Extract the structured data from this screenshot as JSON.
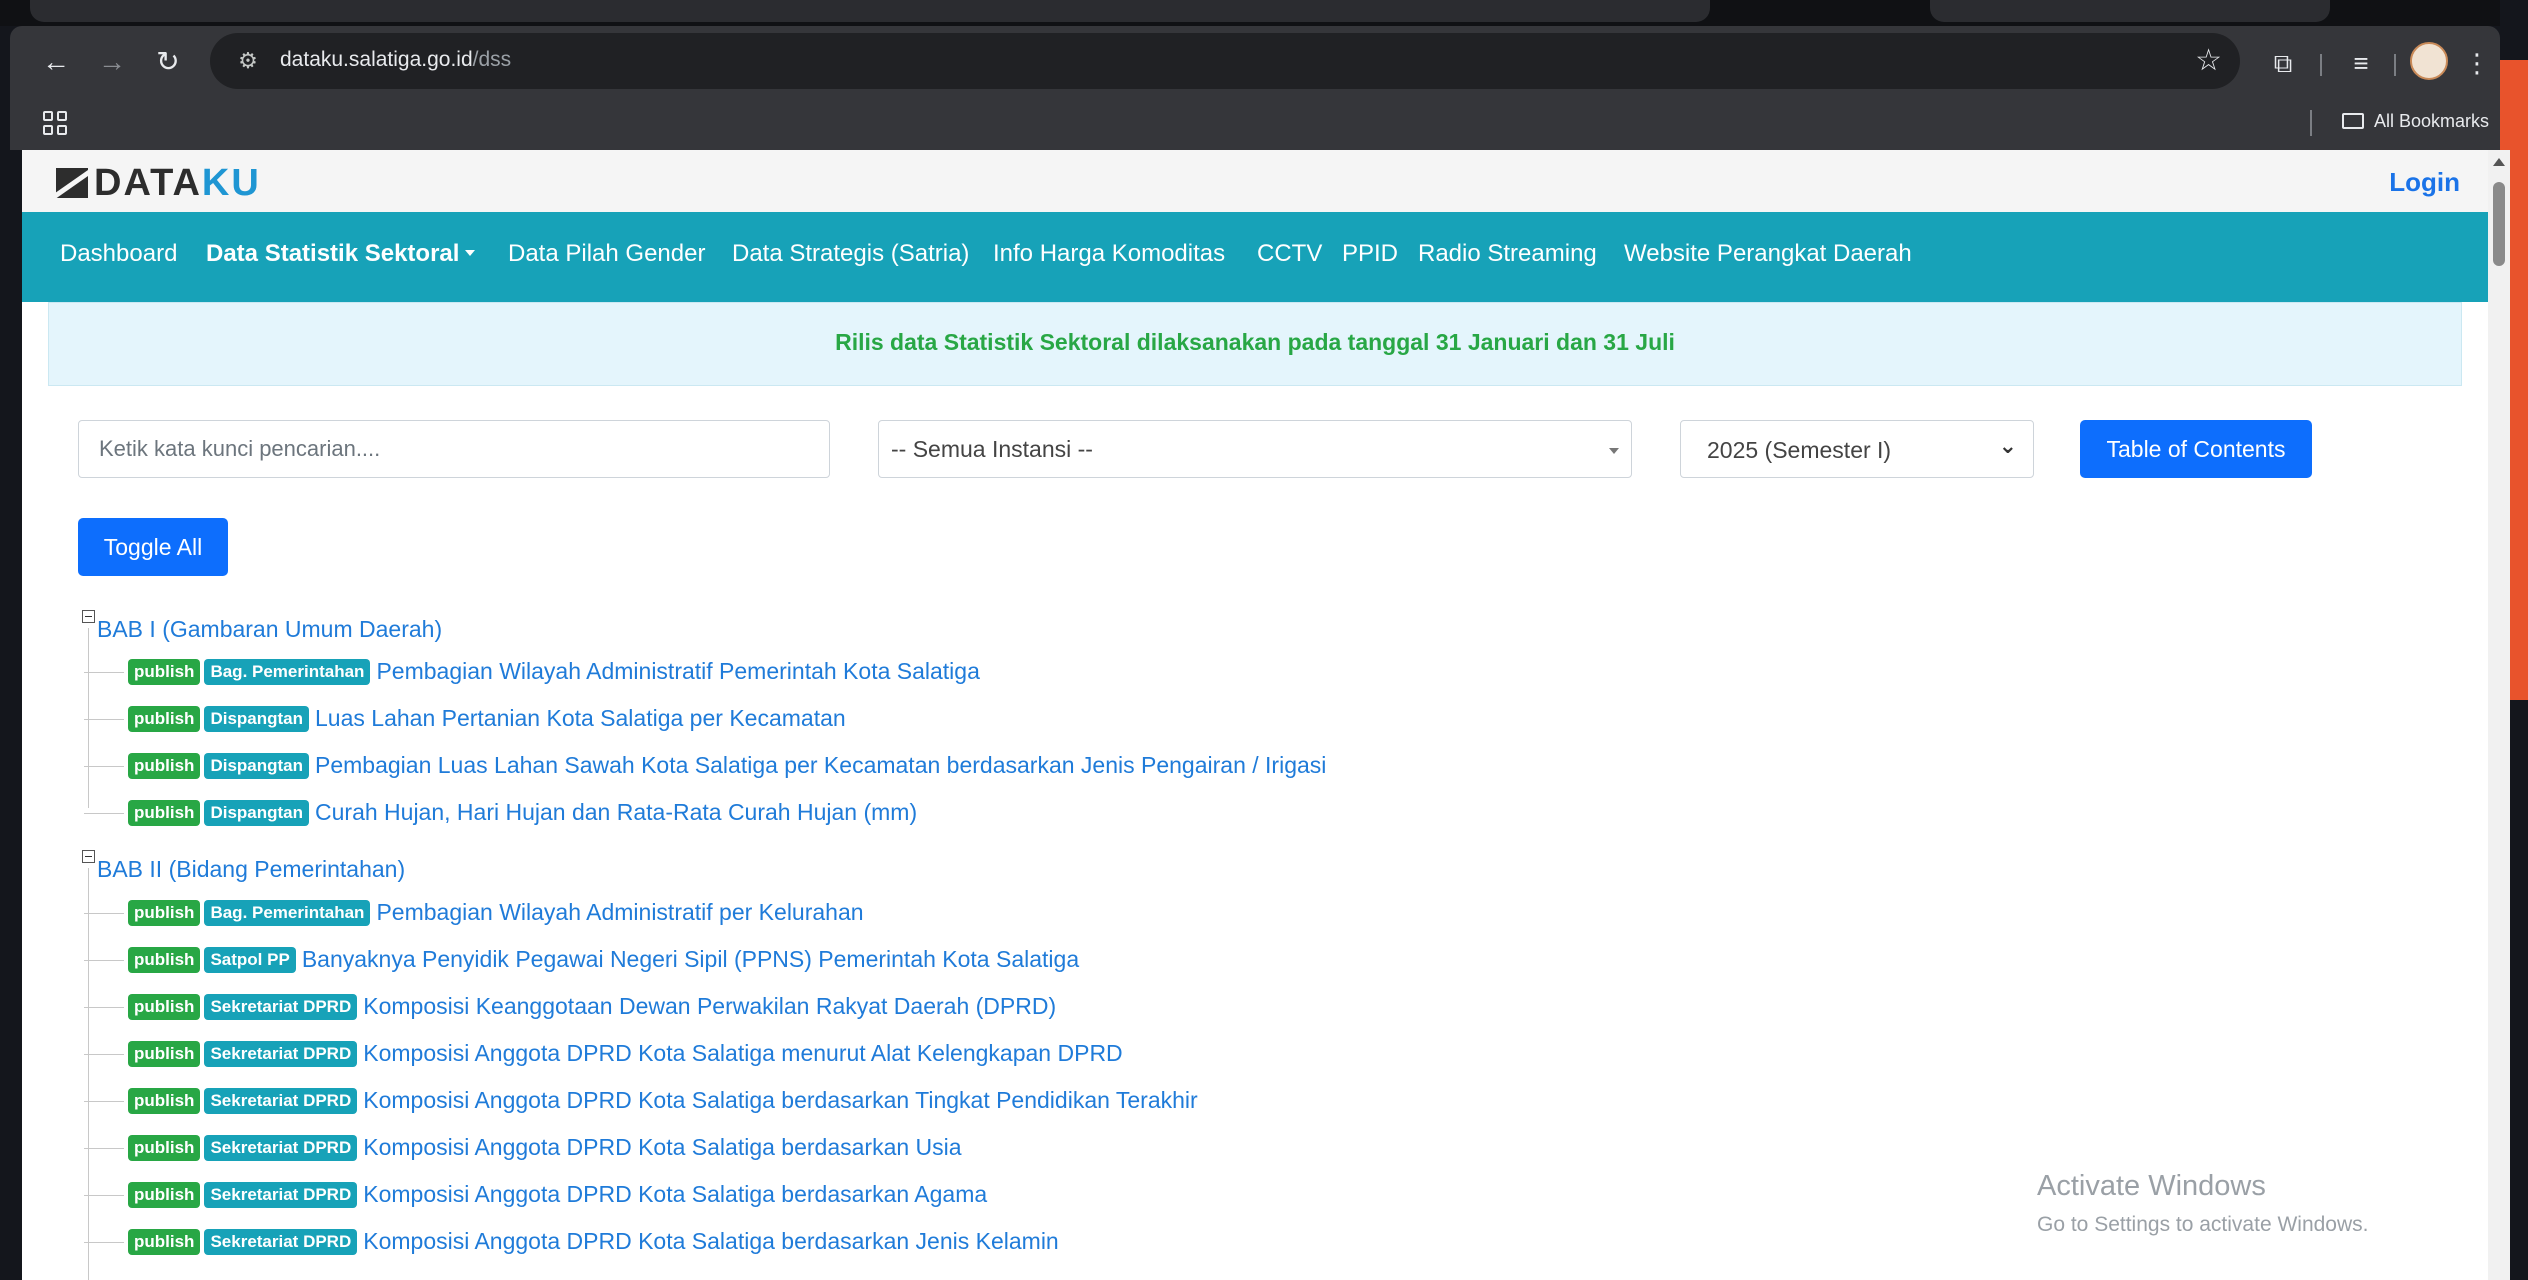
{
  "browser": {
    "url_host": "dataku.salatiga.go.id",
    "url_path": "/dss",
    "all_bookmarks": "All Bookmarks"
  },
  "site": {
    "logo_dark": "DATA",
    "logo_accent": "KU",
    "login": "Login"
  },
  "nav": [
    "Dashboard",
    "Data Statistik Sektoral",
    "Data Pilah Gender",
    "Data Strategis (Satria)",
    "Info Harga Komoditas",
    "CCTV",
    "PPID",
    "Radio Streaming",
    "Website Perangkat Daerah"
  ],
  "notice": "Rilis data Statistik Sektoral dilaksanakan pada tanggal 31 Januari dan 31 Juli",
  "filters": {
    "search_placeholder": "Ketik kata kunci pencarian....",
    "instansi_selected": "-- Semua Instansi --",
    "year_selected": "2025 (Semester I)",
    "toc_button": "Table of Contents",
    "toggle_all": "Toggle All"
  },
  "tree": [
    {
      "title": "BAB I (Gambaran Umum Daerah)",
      "items": [
        {
          "status": "publish",
          "instansi": "Bag. Pemerintahan",
          "title": "Pembagian Wilayah Administratif Pemerintah Kota Salatiga"
        },
        {
          "status": "publish",
          "instansi": "Dispangtan",
          "title": "Luas Lahan Pertanian Kota Salatiga per Kecamatan"
        },
        {
          "status": "publish",
          "instansi": "Dispangtan",
          "title": "Pembagian Luas Lahan Sawah Kota Salatiga per Kecamatan berdasarkan Jenis Pengairan / Irigasi"
        },
        {
          "status": "publish",
          "instansi": "Dispangtan",
          "title": "Curah Hujan, Hari Hujan dan Rata-Rata Curah Hujan (mm)"
        }
      ]
    },
    {
      "title": "BAB II (Bidang Pemerintahan)",
      "items": [
        {
          "status": "publish",
          "instansi": "Bag. Pemerintahan",
          "title": "Pembagian Wilayah Administratif per Kelurahan"
        },
        {
          "status": "publish",
          "instansi": "Satpol PP",
          "title": "Banyaknya Penyidik Pegawai Negeri Sipil (PPNS) Pemerintah Kota Salatiga"
        },
        {
          "status": "publish",
          "instansi": "Sekretariat DPRD",
          "title": "Komposisi Keanggotaan Dewan Perwakilan Rakyat Daerah (DPRD)"
        },
        {
          "status": "publish",
          "instansi": "Sekretariat DPRD",
          "title": "Komposisi Anggota DPRD Kota Salatiga menurut Alat Kelengkapan DPRD"
        },
        {
          "status": "publish",
          "instansi": "Sekretariat DPRD",
          "title": "Komposisi Anggota DPRD Kota Salatiga berdasarkan Tingkat Pendidikan Terakhir"
        },
        {
          "status": "publish",
          "instansi": "Sekretariat DPRD",
          "title": "Komposisi Anggota DPRD Kota Salatiga berdasarkan Usia"
        },
        {
          "status": "publish",
          "instansi": "Sekretariat DPRD",
          "title": "Komposisi Anggota DPRD Kota Salatiga berdasarkan Agama"
        },
        {
          "status": "publish",
          "instansi": "Sekretariat DPRD",
          "title": "Komposisi Anggota DPRD Kota Salatiga berdasarkan Jenis Kelamin"
        }
      ]
    }
  ],
  "watermark": {
    "title": "Activate Windows",
    "subtitle": "Go to Settings to activate Windows."
  }
}
